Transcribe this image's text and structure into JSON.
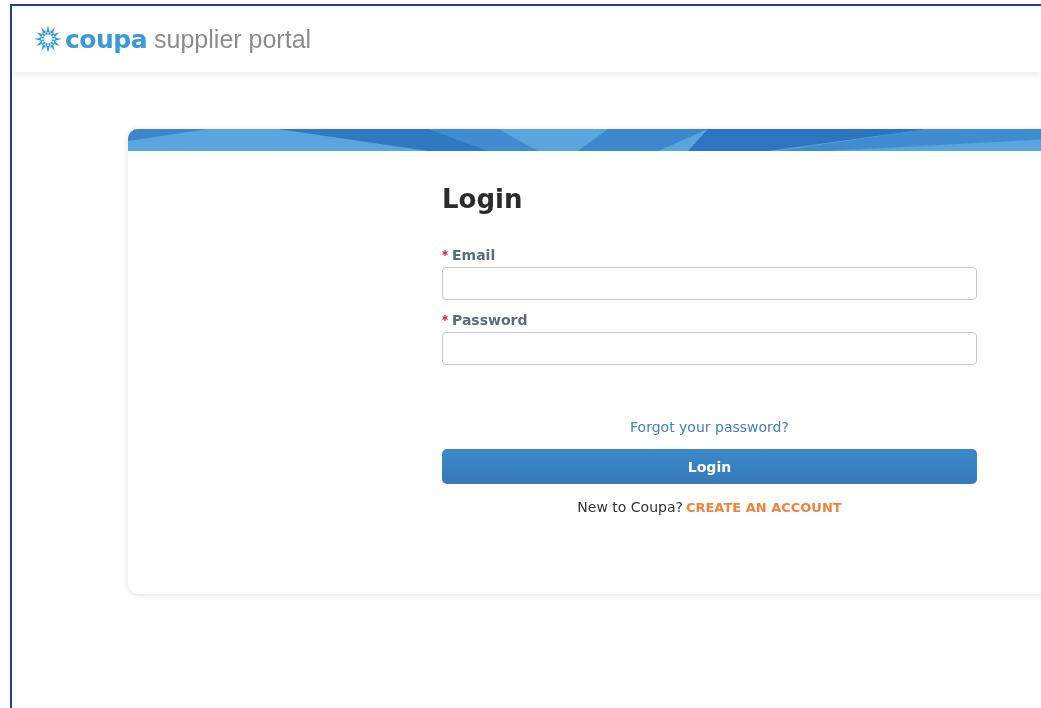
{
  "header": {
    "logo_brand": "coupa",
    "logo_tagline": "supplier portal"
  },
  "login": {
    "title": "Login",
    "fields": [
      {
        "label": "Email",
        "required": true
      },
      {
        "label": "Password",
        "required": true
      }
    ],
    "forgot_link": "Forgot your password?",
    "submit": "Login",
    "signup_prompt": "New to Coupa?",
    "signup_link": "CREATE AN ACCOUNT"
  }
}
